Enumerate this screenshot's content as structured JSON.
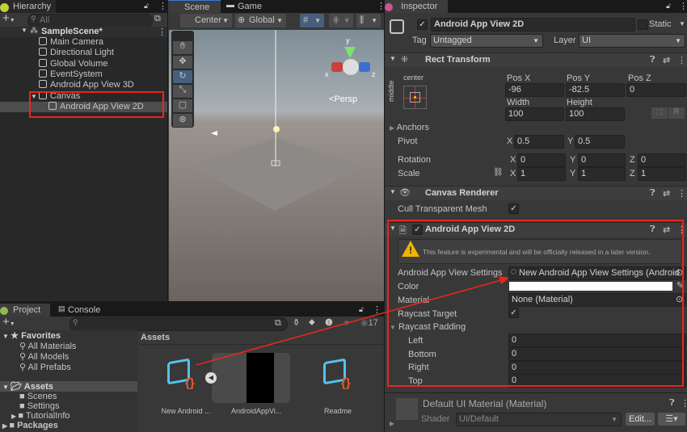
{
  "hierarchy": {
    "tab": "Hierarchy",
    "search_placeholder": "All",
    "scene": "SampleScene*",
    "items": [
      "Main Camera",
      "Directional Light",
      "Global Volume",
      "EventSystem",
      "Android App View 3D",
      "Canvas",
      "Android App View 2D"
    ]
  },
  "scene": {
    "tabs": [
      "Scene",
      "Game"
    ],
    "pivot": "Center",
    "space": "Global",
    "persp": "Persp",
    "axes": {
      "x": "x",
      "y": "y",
      "z": "z"
    }
  },
  "inspector": {
    "tab": "Inspector",
    "object_name": "Android App View 2D",
    "static_label": "Static",
    "tag_label": "Tag",
    "tag_value": "Untagged",
    "layer_label": "Layer",
    "layer_value": "UI",
    "rect_transform": {
      "title": "Rect Transform",
      "anchor_h": "center",
      "anchor_v": "middle",
      "pos_x_label": "Pos X",
      "pos_y_label": "Pos Y",
      "pos_z_label": "Pos Z",
      "pos_x": "-96",
      "pos_y": "-82.5",
      "pos_z": "0",
      "width_label": "Width",
      "height_label": "Height",
      "width": "100",
      "height": "100",
      "r_button": "R",
      "anchors": "Anchors",
      "pivot": "Pivot",
      "pivot_x": "0.5",
      "pivot_y": "0.5",
      "rotation": "Rotation",
      "rot": [
        "0",
        "0",
        "0"
      ],
      "scale": "Scale",
      "scl": [
        "1",
        "1",
        "1"
      ],
      "x": "X",
      "y": "Y",
      "z": "Z"
    },
    "canvas_renderer": {
      "title": "Canvas Renderer",
      "cull": "Cull Transparent Mesh"
    },
    "app_view": {
      "title": "Android App View 2D",
      "warning": "This feature is experimental and will be officially released in a later version.",
      "settings_label": "Android App View Settings",
      "settings_value": "New Android App View Settings (Android",
      "color_label": "Color",
      "color_value": "#ffffff",
      "material_label": "Material",
      "material_value": "None (Material)",
      "raycast_target": "Raycast Target",
      "raycast_padding": "Raycast Padding",
      "left": "Left",
      "bottom": "Bottom",
      "right": "Right",
      "top": "Top",
      "pad": [
        "0",
        "0",
        "0",
        "0"
      ]
    },
    "material": {
      "title": "Default UI Material (Material)",
      "shader_label": "Shader",
      "shader_value": "UI/Default",
      "edit": "Edit..."
    }
  },
  "project": {
    "tabs": [
      "Project",
      "Console"
    ],
    "hidden_count": "17",
    "favorites": "Favorites",
    "fav_items": [
      "All Materials",
      "All Models",
      "All Prefabs"
    ],
    "assets": "Assets",
    "folders": [
      "Scenes",
      "Settings",
      "TutorialInfo"
    ],
    "packages": "Packages",
    "breadcrumb": "Assets",
    "files": [
      "New Android ...",
      "AndroidAppVi...",
      "Readme"
    ]
  },
  "colors": {
    "highlight": "#e8271f",
    "selection": "#4d4d4d"
  }
}
